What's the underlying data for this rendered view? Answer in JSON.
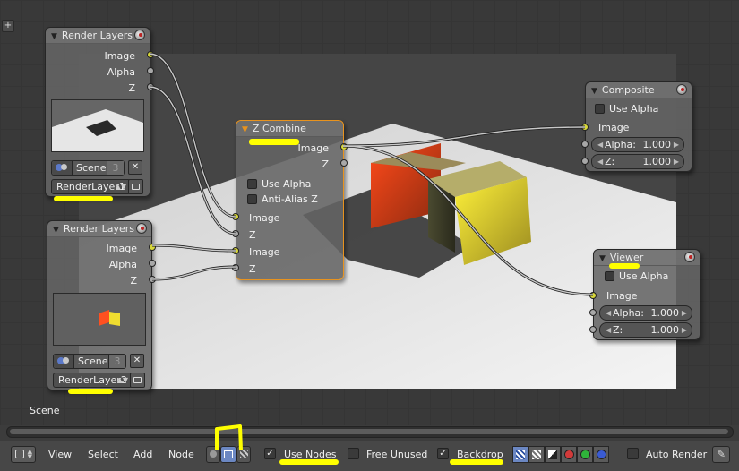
{
  "scene_label": "Scene",
  "nodes": {
    "render_layers_1": {
      "title": "Render Layers",
      "outputs": [
        "Image",
        "Alpha",
        "Z"
      ],
      "scene": "Scene",
      "scene_users": "3",
      "layer": "RenderLayer1"
    },
    "render_layers_2": {
      "title": "Render Layers",
      "outputs": [
        "Image",
        "Alpha",
        "Z"
      ],
      "scene": "Scene",
      "scene_users": "3",
      "layer": "RenderLayer2"
    },
    "z_combine": {
      "title": "Z Combine",
      "output_image": "Image",
      "output_z": "Z",
      "use_alpha": "Use Alpha",
      "anti_alias": "Anti-Alias Z",
      "inputs": [
        "Image",
        "Z",
        "Image",
        "Z"
      ]
    },
    "composite": {
      "title": "Composite",
      "use_alpha": "Use Alpha",
      "input_image": "Image",
      "alpha_label": "Alpha:",
      "alpha_value": "1.000",
      "z_label": "Z:",
      "z_value": "1.000"
    },
    "viewer": {
      "title": "Viewer",
      "use_alpha": "Use Alpha",
      "input_image": "Image",
      "alpha_label": "Alpha:",
      "alpha_value": "1.000",
      "z_label": "Z:",
      "z_value": "1.000"
    }
  },
  "header": {
    "menu": [
      "View",
      "Select",
      "Add",
      "Node"
    ],
    "use_nodes": "Use Nodes",
    "free_unused": "Free Unused",
    "backdrop": "Backdrop",
    "auto_render": "Auto Render",
    "check_mark": "✓"
  },
  "colors": {
    "highlight": "#ffff00",
    "active_node": "#e8931e",
    "image_socket": "#d8d83a",
    "value_socket": "#a8a8a8"
  }
}
